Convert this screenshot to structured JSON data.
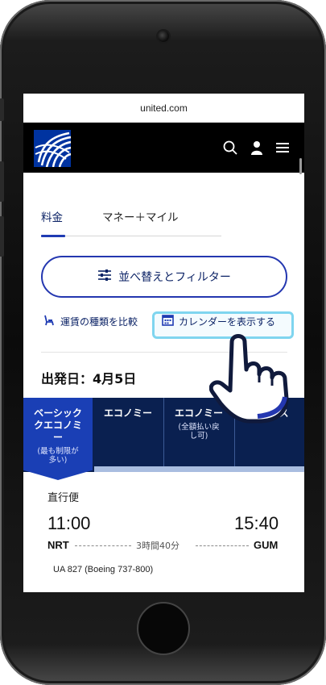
{
  "browser": {
    "url": "united.com"
  },
  "header": {
    "logo": "globe-logo",
    "icons": [
      "search-icon",
      "account-icon",
      "menu-icon"
    ]
  },
  "tabs": [
    {
      "label": "料金",
      "active": true
    },
    {
      "label": "マネー＋マイル",
      "active": false
    }
  ],
  "sort_filter_button": {
    "label": "並べ替えとフィルター",
    "icon": "sliders-icon"
  },
  "links": {
    "compare": {
      "label": "運賃の種類を比較",
      "icon": "seat-icon"
    },
    "calendar": {
      "label": "カレンダーを表示する",
      "icon": "calendar-icon"
    }
  },
  "departure_date": "出発日：4月5日",
  "fare_columns": [
    {
      "name": "ベーシッククエコノミー",
      "note": "(最も制限が多い)",
      "selected": true
    },
    {
      "name": "エコノミー",
      "note": ""
    },
    {
      "name": "エコノミー",
      "note": "(全額払い戻し可)"
    },
    {
      "name": "ビジネス",
      "note": ""
    }
  ],
  "flight": {
    "type": "直行便",
    "depart_time": "11:00",
    "arrive_time": "15:40",
    "origin": "NRT",
    "destination": "GUM",
    "duration": "3時間40分",
    "flight_no": "UA 827 (Boeing 737-800)"
  },
  "colors": {
    "brand_navy": "#0c2366",
    "accent_blue": "#2437b0",
    "highlight": "#7fd5ef"
  }
}
